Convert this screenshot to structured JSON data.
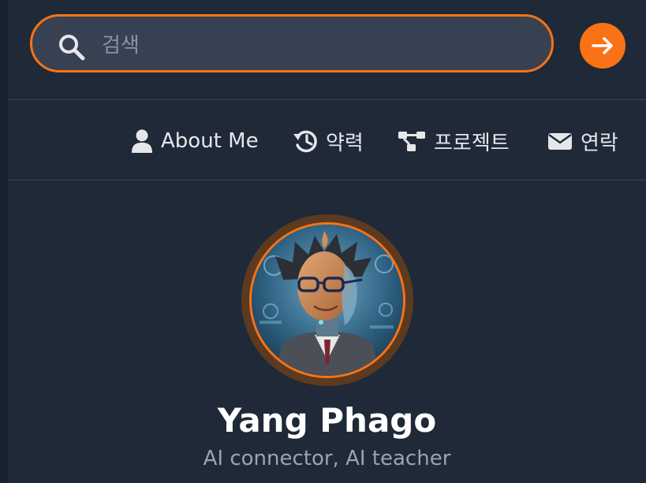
{
  "search": {
    "placeholder": "검색",
    "value": "",
    "icon": "search-icon",
    "submit_icon": "arrow-right-icon"
  },
  "nav": {
    "items": [
      {
        "label": "About Me",
        "icon": "user-icon"
      },
      {
        "label": "약력",
        "icon": "history-icon"
      },
      {
        "label": "프로젝트",
        "icon": "sitemap-icon"
      },
      {
        "label": "연락",
        "icon": "envelope-icon"
      }
    ]
  },
  "profile": {
    "name": "Yang Phago",
    "tagline": "AI connector, AI teacher"
  },
  "colors": {
    "background": "#1f2937",
    "accent": "#f97316",
    "input_bg": "#374151",
    "text": "#e5e7eb",
    "muted": "#9ca3af"
  }
}
